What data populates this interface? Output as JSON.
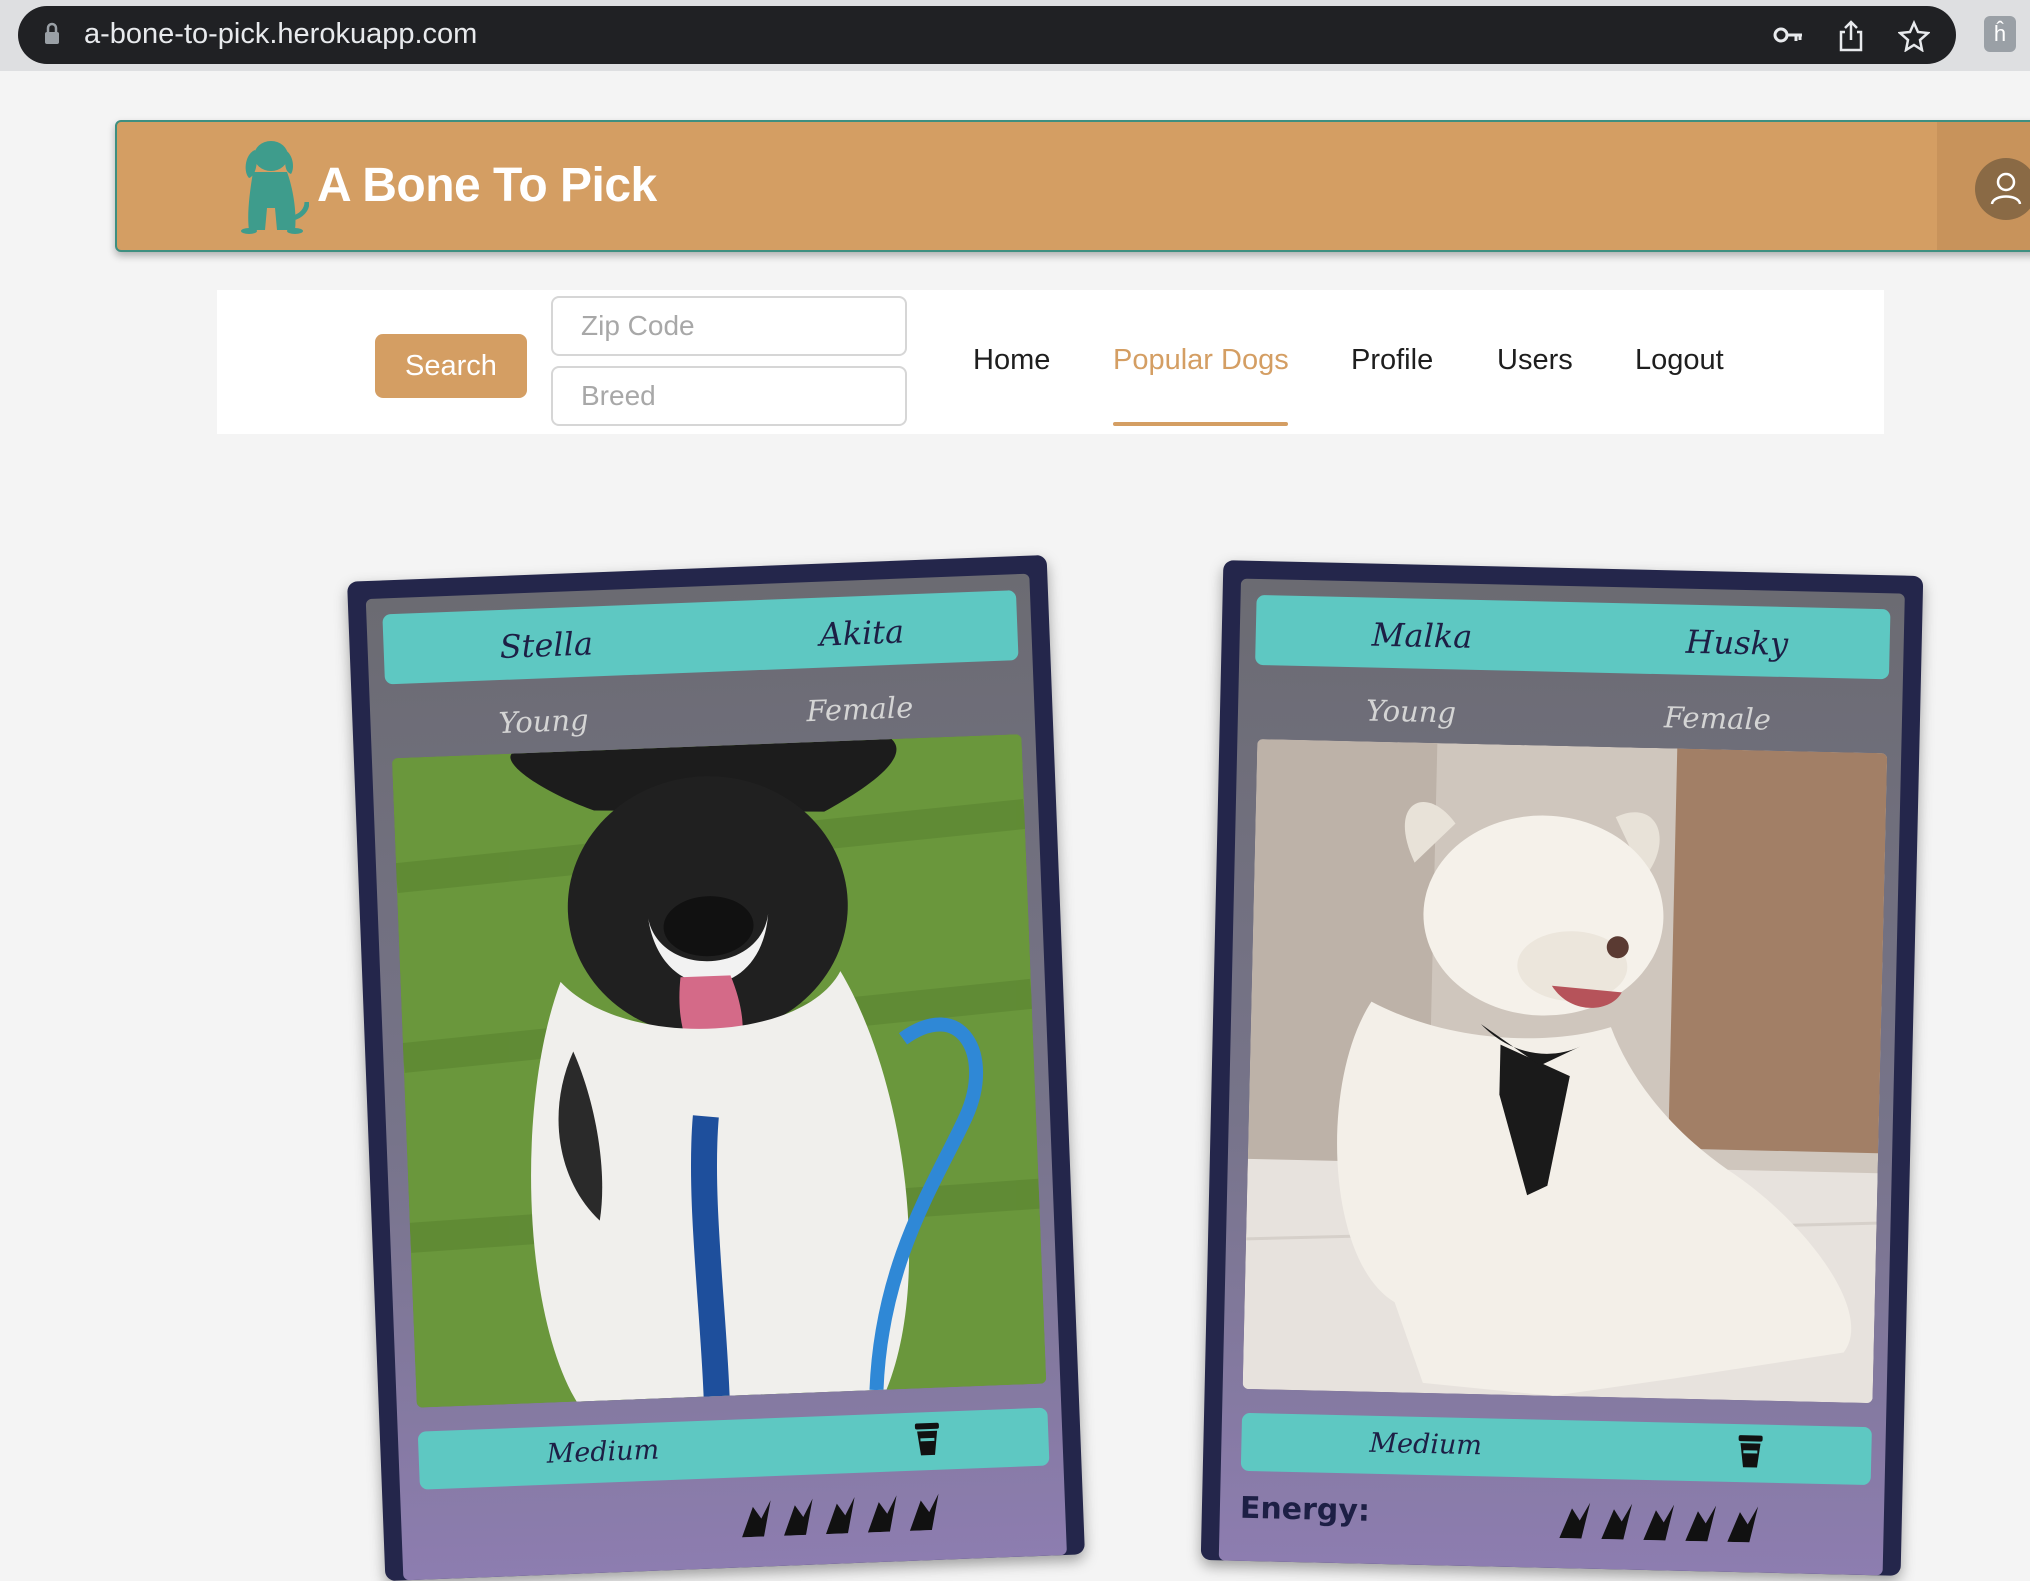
{
  "browser": {
    "url": "a-bone-to-pick.herokuapp.com",
    "icons": [
      "lock-icon",
      "key-icon",
      "share-icon",
      "star-icon",
      "extension-icon"
    ],
    "extension_label": "ĥ"
  },
  "header": {
    "brand": "A Bone To Pick",
    "logo": "dog-logo-icon",
    "profile_icon": "user-icon",
    "colors": {
      "primary": "#d49e63",
      "accent": "#3e9c8c"
    }
  },
  "nav": {
    "search_label": "Search",
    "zip_placeholder": "Zip Code",
    "breed_placeholder": "Breed",
    "links": [
      {
        "label": "Home",
        "active": false
      },
      {
        "label": "Popular Dogs",
        "active": true
      },
      {
        "label": "Profile",
        "active": false
      },
      {
        "label": "Users",
        "active": false
      },
      {
        "label": "Logout",
        "active": false
      }
    ]
  },
  "dogs": [
    {
      "name": "Stella",
      "breed": "Akita",
      "age": "Young",
      "sex": "Female",
      "size": "Medium",
      "energy_label": "",
      "energy_level": 5
    },
    {
      "name": "Malka",
      "breed": "Husky",
      "age": "Young",
      "sex": "Female",
      "size": "Medium",
      "energy_label": "Energy:",
      "energy_level": 5
    }
  ]
}
